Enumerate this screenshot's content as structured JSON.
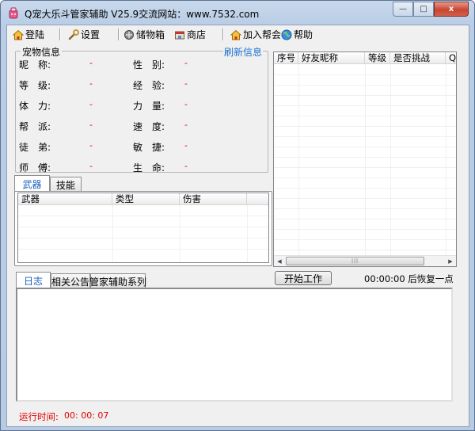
{
  "window": {
    "title": "Q宠大乐斗管家辅助 V25.9交流网站：www.7532.com",
    "minimize_glyph": "—",
    "maximize_glyph": "□",
    "close_glyph": "x"
  },
  "toolbar": {
    "items": [
      {
        "label": "登陆",
        "icon": "house-icon"
      },
      {
        "label": "设置",
        "icon": "wrench-icon"
      },
      {
        "label": "储物箱",
        "icon": "storage-icon"
      },
      {
        "label": "商店",
        "icon": "shop-icon"
      },
      {
        "label": "加入帮会",
        "icon": "house-icon"
      },
      {
        "label": "帮助",
        "icon": "help-globe-icon"
      }
    ]
  },
  "pet_info": {
    "title": "宠物信息",
    "refresh_label": "刷新信息",
    "fields": [
      {
        "label": "昵　称:",
        "value": "-"
      },
      {
        "label": "性　别:",
        "value": "-"
      },
      {
        "label": "等　级:",
        "value": "-"
      },
      {
        "label": "经　验:",
        "value": "-"
      },
      {
        "label": "体　力:",
        "value": "-"
      },
      {
        "label": "力　量:",
        "value": "-"
      },
      {
        "label": "帮　派:",
        "value": "-"
      },
      {
        "label": "速　度:",
        "value": "-"
      },
      {
        "label": "徒　弟:",
        "value": "-"
      },
      {
        "label": "敏　捷:",
        "value": "-"
      },
      {
        "label": "师　傅:",
        "value": "-"
      },
      {
        "label": "生　命:",
        "value": "-"
      }
    ]
  },
  "weapon_tabs": {
    "tabs": [
      "武器",
      "技能"
    ],
    "active": 0,
    "columns": [
      "武器",
      "类型",
      "伤害"
    ]
  },
  "friends_list": {
    "columns": [
      "序号",
      "好友昵称",
      "等级",
      "是否挑战",
      "QQ"
    ]
  },
  "bottom_tabs": {
    "tabs": [
      "日志",
      "相关公告",
      "管家辅助系列"
    ],
    "active": 0
  },
  "start_button": {
    "label": "开始工作"
  },
  "countdown": {
    "text": "00:00:00 后恢复一点"
  },
  "status": {
    "runtime_label": "运行时间:",
    "runtime_value": "00: 00: 07"
  },
  "colors": {
    "accent_link": "#1a70d0",
    "value_red": "#e00000",
    "active_tab": "#1a5fc0"
  }
}
